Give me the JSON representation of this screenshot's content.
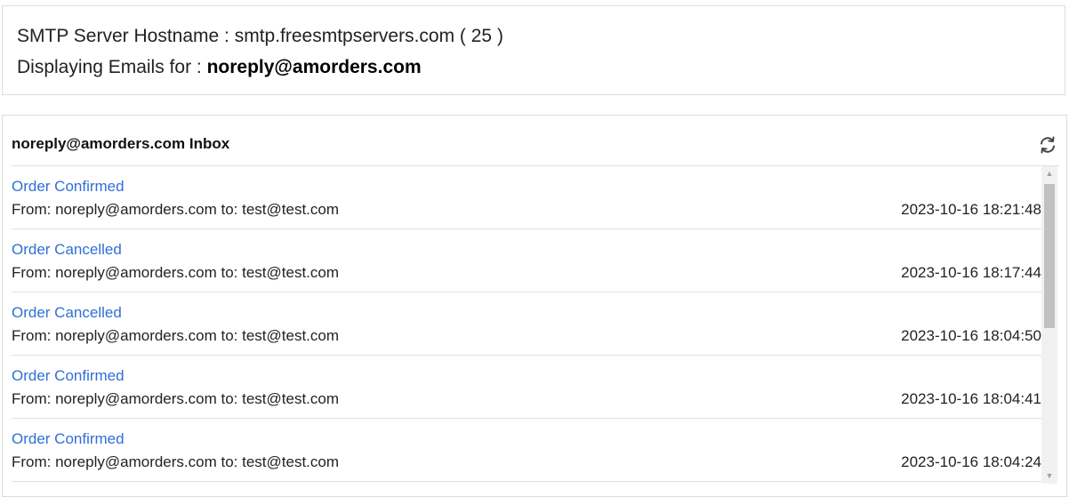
{
  "server": {
    "hostname_label": "SMTP Server Hostname :",
    "hostname_value": "smtp.freesmtpservers.com ( 25 )",
    "display_label": "Displaying Emails for :",
    "display_email": "noreply@amorders.com"
  },
  "inbox": {
    "title": "noreply@amorders.com Inbox",
    "refresh_icon": "refresh-icon",
    "emails": [
      {
        "subject": "Order Confirmed",
        "from_to": "From: noreply@amorders.com to: test@test.com",
        "date": "2023-10-16 18:21:48"
      },
      {
        "subject": "Order Cancelled",
        "from_to": "From: noreply@amorders.com to: test@test.com",
        "date": "2023-10-16 18:17:44"
      },
      {
        "subject": "Order Cancelled",
        "from_to": "From: noreply@amorders.com to: test@test.com",
        "date": "2023-10-16 18:04:50"
      },
      {
        "subject": "Order Confirmed",
        "from_to": "From: noreply@amorders.com to: test@test.com",
        "date": "2023-10-16 18:04:41"
      },
      {
        "subject": "Order Confirmed",
        "from_to": "From: noreply@amorders.com to: test@test.com",
        "date": "2023-10-16 18:04:24"
      }
    ]
  },
  "colors": {
    "link": "#2f6fd6",
    "border": "#dcdcdc",
    "scrollbar_thumb": "#c1c1c1"
  }
}
